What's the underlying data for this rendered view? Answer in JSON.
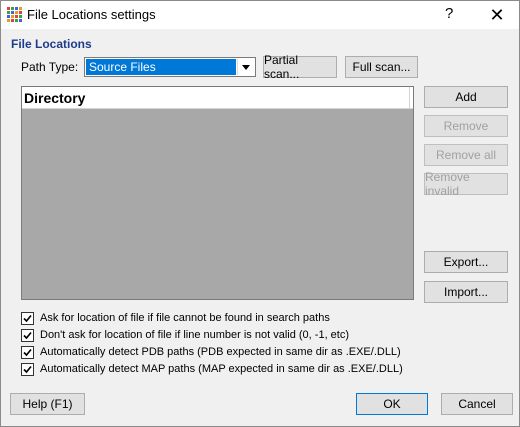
{
  "window": {
    "title": "File Locations settings",
    "help_glyph": "?",
    "close_glyph": "✕"
  },
  "section": {
    "title": "File Locations"
  },
  "path_type": {
    "label": "Path Type:",
    "selected": "Source Files"
  },
  "scan_buttons": {
    "partial": "Partial scan...",
    "full": "Full scan..."
  },
  "list": {
    "columns": [
      "Directory"
    ],
    "rows": []
  },
  "side_buttons": {
    "add": "Add",
    "remove": "Remove",
    "remove_all": "Remove all",
    "remove_invalid": "Remove invalid",
    "export": "Export...",
    "import": "Import..."
  },
  "options": [
    {
      "label": "Ask for location of file if file cannot be found in search paths",
      "checked": true
    },
    {
      "label": "Don't ask for location of file if line number is not valid (0, -1, etc)",
      "checked": true
    },
    {
      "label": "Automatically detect PDB paths (PDB expected in same dir as .EXE/.DLL)",
      "checked": true
    },
    {
      "label": "Automatically detect MAP paths (MAP expected in same dir as .EXE/.DLL)",
      "checked": true
    }
  ],
  "footer": {
    "help": "Help (F1)",
    "ok": "OK",
    "cancel": "Cancel"
  },
  "colors": {
    "section_title": "#1e3c8c",
    "selection": "#0078d7",
    "list_background": "#a8a8a8"
  }
}
